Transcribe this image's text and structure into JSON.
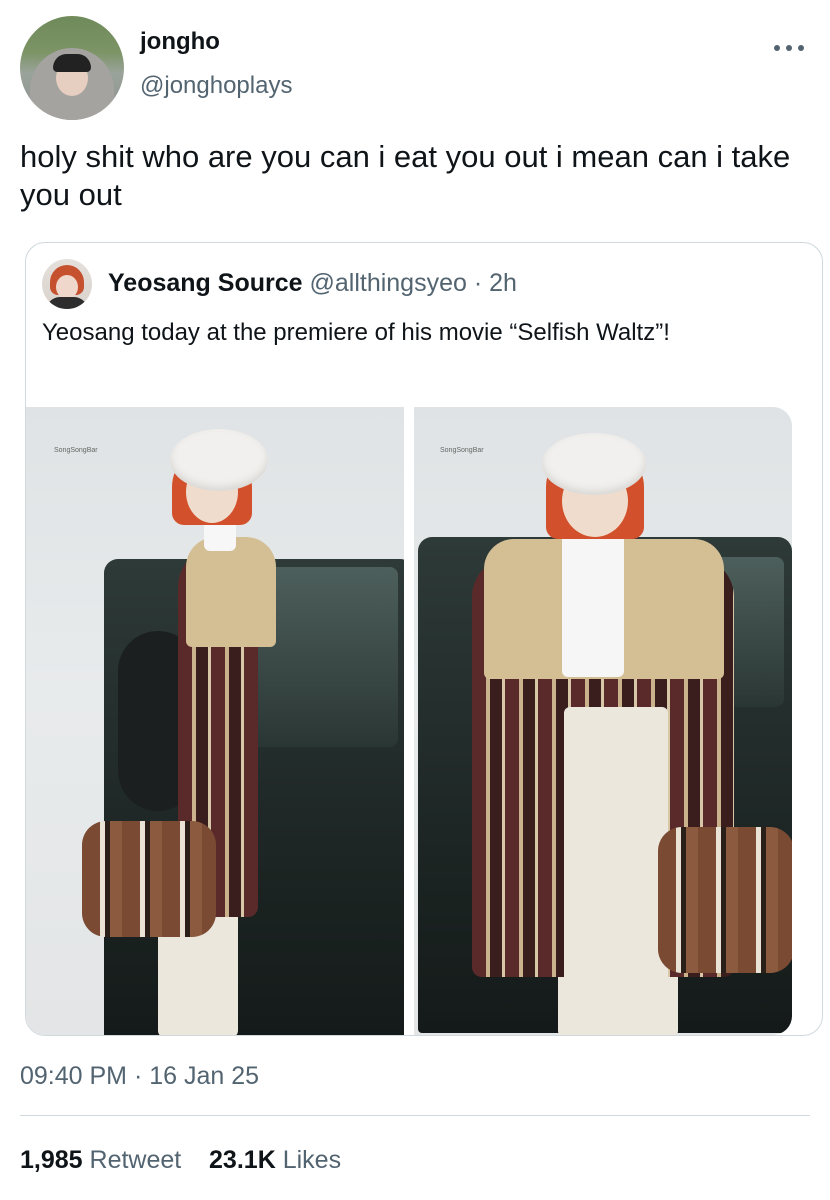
{
  "author": {
    "display_name": "jongho",
    "handle": "@jonghoplays"
  },
  "tweet": {
    "text": "holy shit who are you can i eat you out i mean can i take you out",
    "timestamp": "09:40 PM · 16 Jan 25"
  },
  "quoted": {
    "display_name": "Yeosang Source",
    "handle": "@allthingsyeo",
    "separator": " · ",
    "time": "2h",
    "text": "Yeosang today at the premiere of his movie “Selfish Waltz”!",
    "watermark": "SongSongBar"
  },
  "stats": {
    "retweets": "1,985",
    "retweets_label": "Retweet",
    "likes": "23.1K",
    "likes_label": "Likes"
  },
  "icons": {
    "more": "more-horizontal-icon"
  },
  "colors": {
    "text_primary": "#0f1419",
    "text_secondary": "#536471",
    "border": "#cfd9de"
  }
}
